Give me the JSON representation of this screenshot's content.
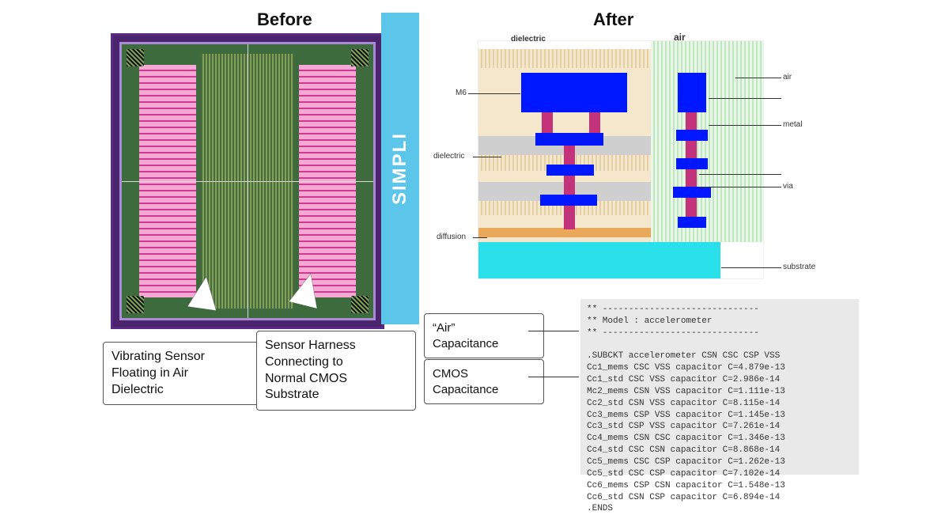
{
  "titles": {
    "before": "Before",
    "after": "After"
  },
  "simpli": "SIMPLI",
  "callouts": {
    "vibrating": "Vibrating Sensor\nFloating in Air\nDielectric",
    "harness": "Sensor Harness\nConnecting to\nNormal CMOS\nSubstrate",
    "air_cap": "“Air”\nCapacitance",
    "cmos_cap": "CMOS\nCapacitance"
  },
  "cross_section": {
    "top_labels": {
      "dielectric": "dielectric",
      "air": "air"
    },
    "side_labels": {
      "m6": "M6",
      "dielectric": "dielectric",
      "diffusion": "diffusion",
      "air": "air",
      "metal": "metal",
      "via": "via",
      "substrate": "substrate"
    }
  },
  "netlist": {
    "header": "** ------------------------------\n** Model : accelerometer\n** ------------------------------",
    "subckt": ".SUBCKT accelerometer CSN CSC CSP VSS",
    "lines": [
      "Cc1_mems CSC VSS capacitor C=4.879e-13",
      "Cc1_std CSC VSS capacitor C=2.986e-14",
      "Mc2_mems CSN VSS capacitor C=1.111e-13",
      "Cc2_std CSN VSS capacitor C=8.115e-14",
      "Cc3_mems CSP VSS capacitor C=1.145e-13",
      "Cc3_std CSP VSS capacitor C=7.261e-14",
      "Cc4_mems CSN CSC capacitor C=1.346e-13",
      "Cc4_std CSC CSN capacitor C=8.868e-14",
      "Cc5_mems CSC CSP capacitor C=1.262e-13",
      "Cc5_std CSC CSP capacitor C=7.102e-14",
      "Cc6_mems CSP CSN capacitor C=1.548e-13",
      "Cc6_std CSN CSP capacitor C=6.894e-14"
    ],
    "ends": ".ENDS"
  }
}
